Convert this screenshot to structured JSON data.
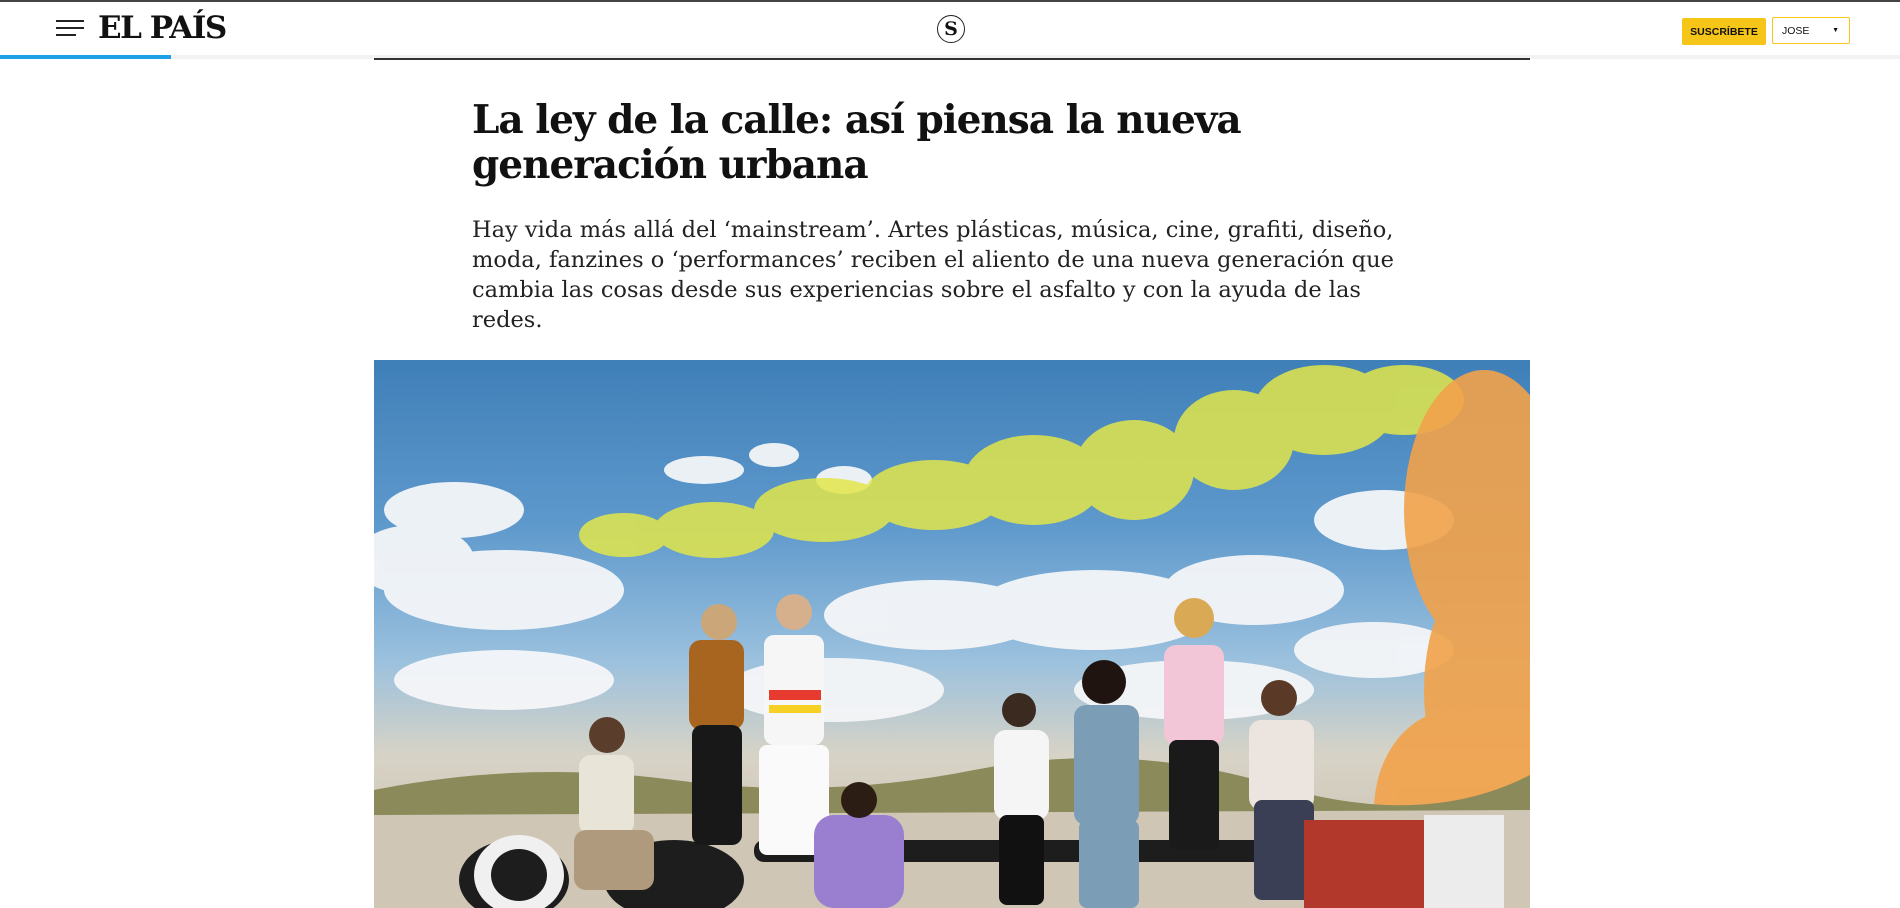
{
  "header": {
    "menu_icon": "hamburger-menu-icon",
    "logo_text": "EL PAÍS",
    "section_logo_text": "S",
    "subscribe_label": "SUSCRÍBETE",
    "user_label": "JOSE",
    "user_caret_icon": "chevron-down-icon",
    "progress": 0.09
  },
  "article": {
    "headline": "La ley de la calle: así piensa la nueva generación urbana",
    "subheadline": "Hay vida más allá del ‘mainstream’. Artes plásticas, música, cine, grafiti, diseño, moda, fanzines o ‘performances’ reciben el aliento de una nueva generación que cambia las cosas desde sus experiencias sobre el asfalto y con la ayuda de las redes."
  },
  "colors": {
    "accent_progress": "#1ea0e6",
    "subscribe_bg": "#f5c518"
  }
}
